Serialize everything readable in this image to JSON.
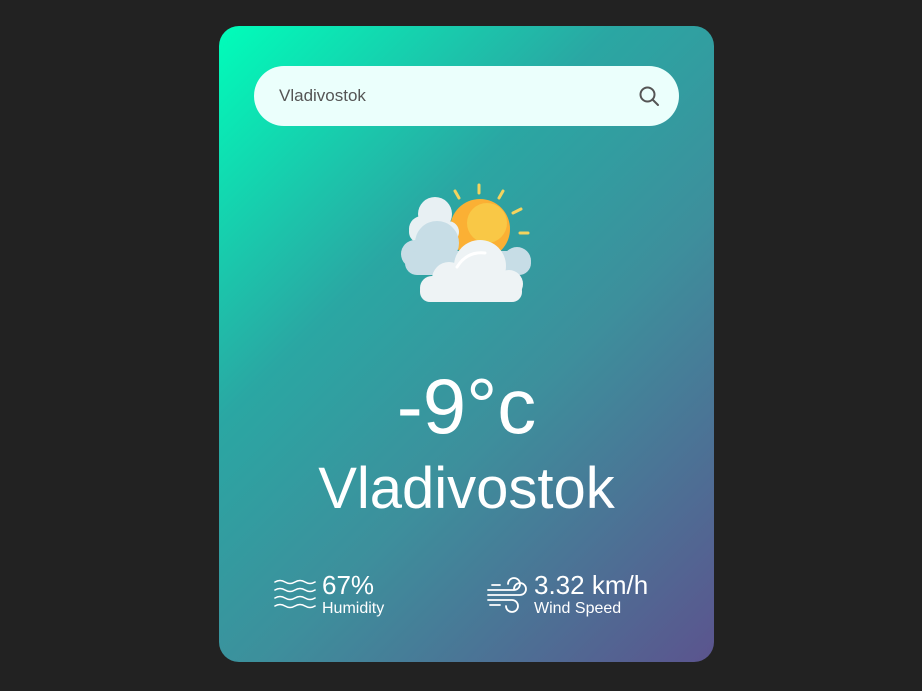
{
  "search": {
    "value": "Vladivostok",
    "icon": "search-icon"
  },
  "weather": {
    "icon": "partly-cloudy-icon",
    "temperature": "-9°c",
    "city": "Vladivostok"
  },
  "details": {
    "humidity": {
      "value": "67%",
      "label": "Humidity",
      "icon": "humidity-icon"
    },
    "wind": {
      "value": "3.32 km/h",
      "label": "Wind Speed",
      "icon": "wind-icon"
    }
  },
  "colors": {
    "background": "#222222",
    "gradient_start": "#00feba",
    "gradient_end": "#5b548e",
    "search_bg": "#ebfffc"
  }
}
